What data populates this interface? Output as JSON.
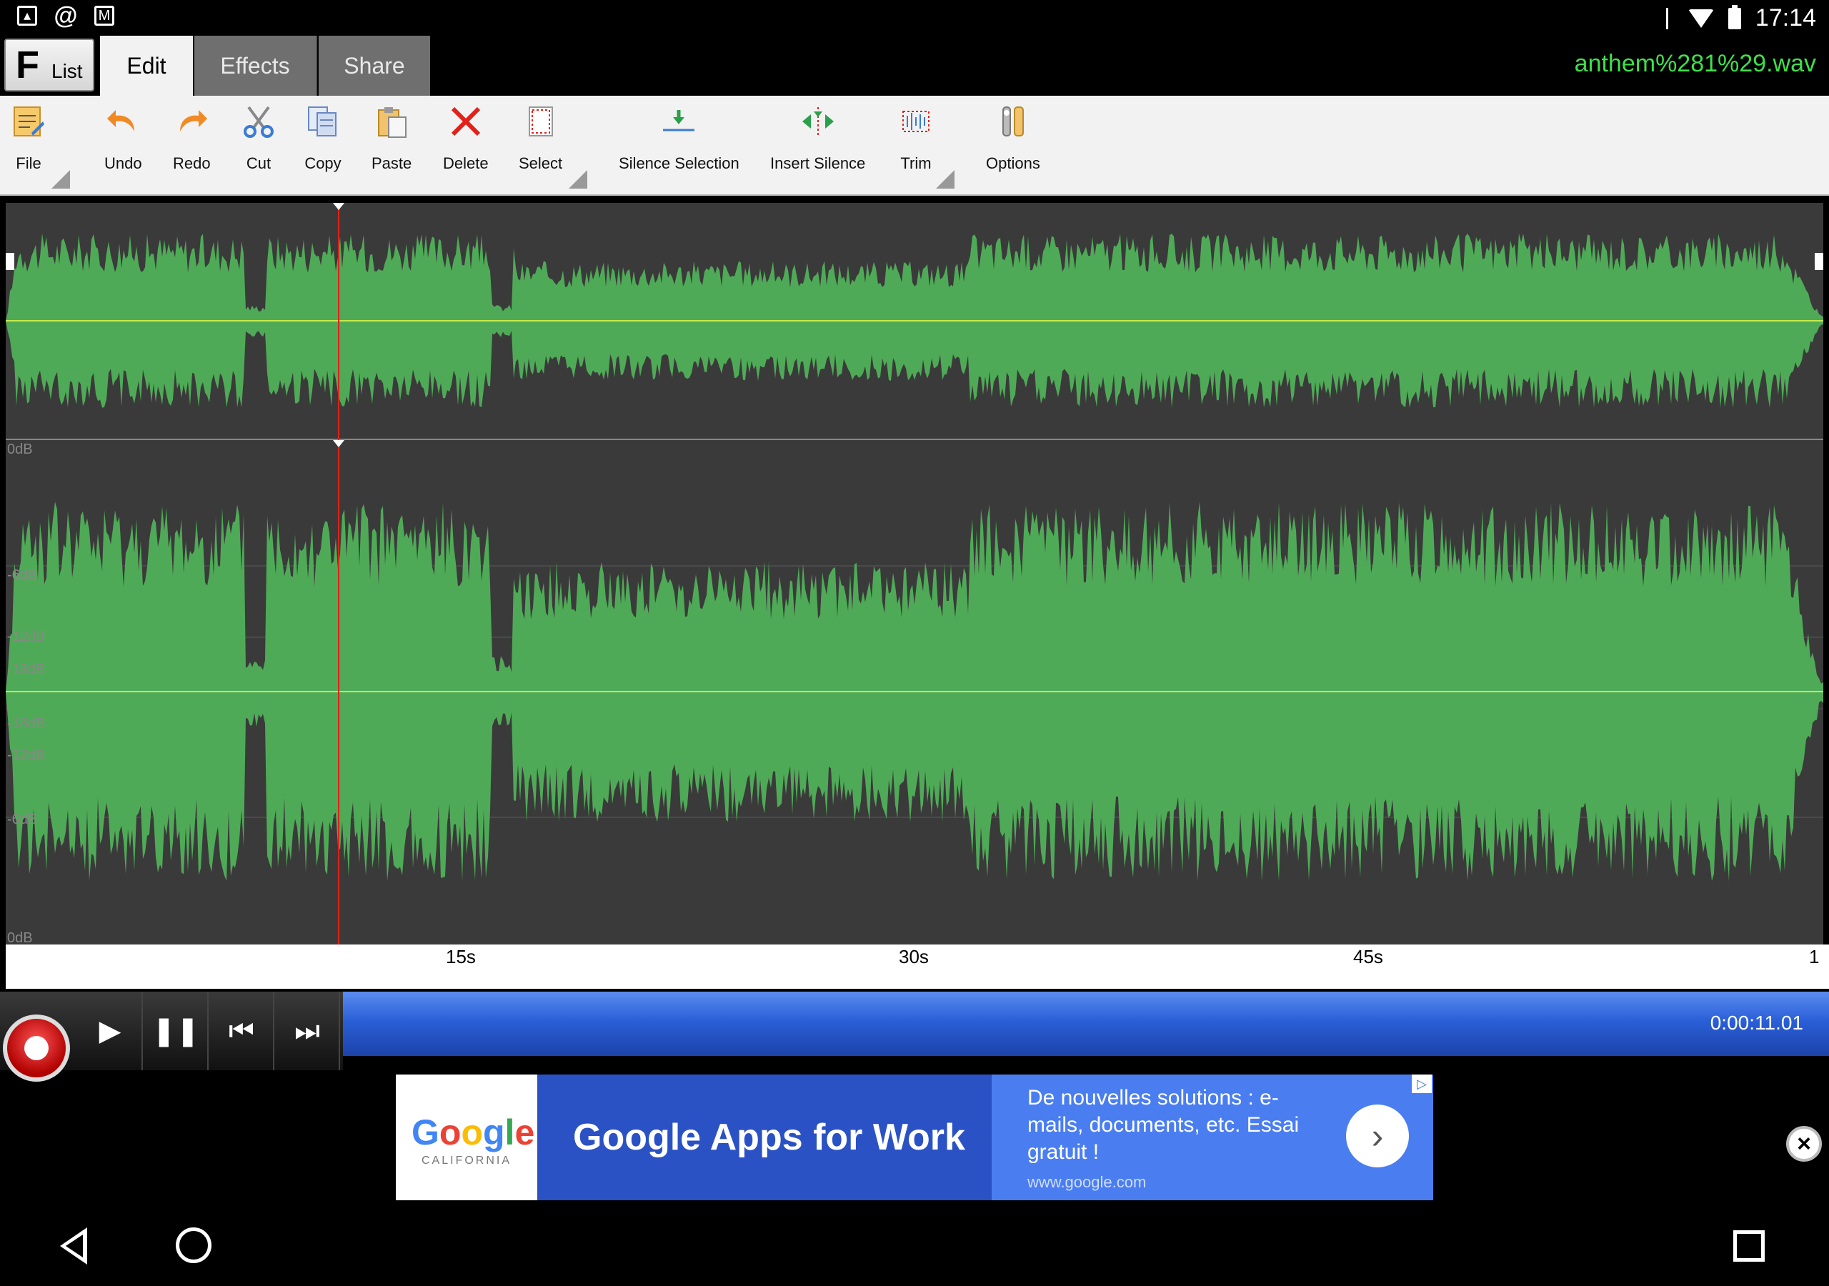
{
  "status_bar": {
    "time": "17:14"
  },
  "tabs": {
    "list_label": "List",
    "items": [
      {
        "label": "Edit",
        "active": true
      },
      {
        "label": "Effects",
        "active": false
      },
      {
        "label": "Share",
        "active": false
      }
    ]
  },
  "filename": "anthem%281%29.wav",
  "toolbar": {
    "file": "File",
    "undo": "Undo",
    "redo": "Redo",
    "cut": "Cut",
    "copy": "Copy",
    "paste": "Paste",
    "delete": "Delete",
    "select": "Select",
    "silence_selection": "Silence Selection",
    "insert_silence": "Insert Silence",
    "trim": "Trim",
    "options": "Options"
  },
  "waveform": {
    "db_labels": [
      "0dB",
      "-6dB",
      "-12dB",
      "-18dB",
      "-18dB",
      "-12dB",
      "-6dB",
      "0dB"
    ],
    "playhead_seconds": 11.01,
    "wave_color": "#4faa57",
    "background_color": "#3a3a3a",
    "center_line_color": "#c8e84a"
  },
  "timeline": {
    "ticks": [
      "15s",
      "30s",
      "45s",
      "1"
    ]
  },
  "transport": {
    "time": "0:00:11.01"
  },
  "ad": {
    "brand": "Google",
    "brand_sub": "CALIFORNIA",
    "title": "Google Apps for Work",
    "description": "De nouvelles solutions : e-mails, documents, etc. Essai gratuit !",
    "url": "www.google.com"
  },
  "colors": {
    "accent_green": "#3fe04a",
    "transport_blue": "#2a5fd8"
  }
}
